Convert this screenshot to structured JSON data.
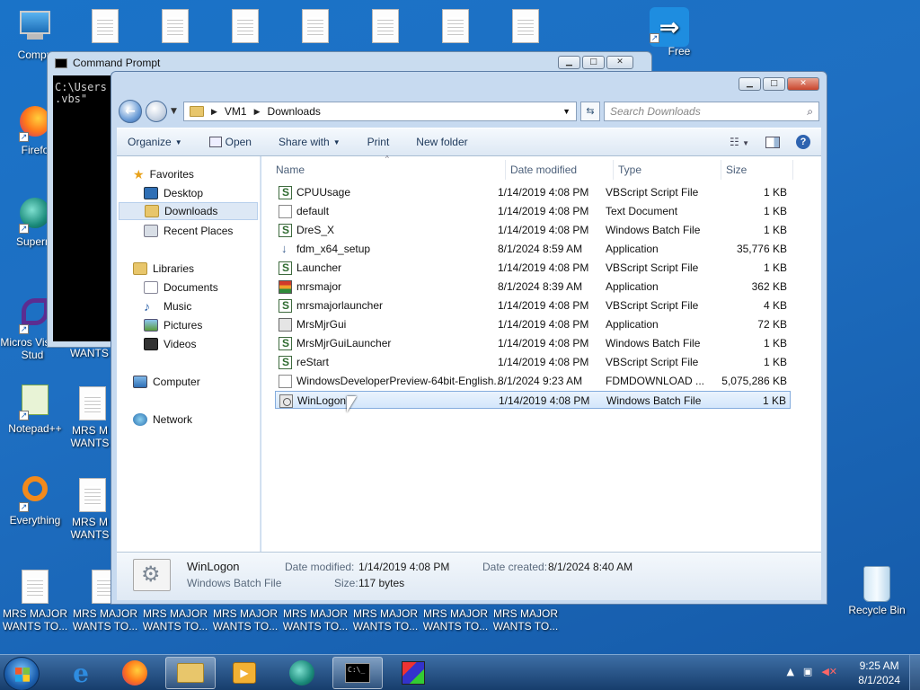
{
  "desktop": {
    "icons": [
      {
        "label": "Compu"
      },
      {
        "label": "Firefo"
      },
      {
        "label": "Superm"
      },
      {
        "label": "Micros Visual Stud"
      },
      {
        "label": "Notepad++"
      },
      {
        "label": "Everything"
      },
      {
        "label": "Free"
      },
      {
        "label": "Recycle Bin"
      }
    ],
    "mrs_label": "MRS MAJOR WANTS TO...",
    "partial_label": "MRS M WANTS",
    "partial_label_short": "WANTS"
  },
  "cmd": {
    "title": "Command Prompt",
    "lines": [
      "C:\\Users",
      ".vbs\""
    ]
  },
  "explorer": {
    "breadcrumb": [
      "VM1",
      "Downloads"
    ],
    "search_placeholder": "Search Downloads",
    "toolbar": {
      "organize": "Organize",
      "open": "Open",
      "share_with": "Share with",
      "print": "Print",
      "new_folder": "New folder"
    },
    "nav": {
      "favorites": "Favorites",
      "desktop": "Desktop",
      "downloads": "Downloads",
      "recent_places": "Recent Places",
      "libraries": "Libraries",
      "documents": "Documents",
      "music": "Music",
      "pictures": "Pictures",
      "videos": "Videos",
      "computer": "Computer",
      "network": "Network"
    },
    "columns": {
      "name": "Name",
      "date": "Date modified",
      "type": "Type",
      "size": "Size"
    },
    "files": [
      {
        "name": "CPUUsage",
        "date": "1/14/2019 4:08 PM",
        "type": "VBScript Script File",
        "size": "1 KB",
        "icon": "script"
      },
      {
        "name": "default",
        "date": "1/14/2019 4:08 PM",
        "type": "Text Document",
        "size": "1 KB",
        "icon": "txt"
      },
      {
        "name": "DreS_X",
        "date": "1/14/2019 4:08 PM",
        "type": "Windows Batch File",
        "size": "1 KB",
        "icon": "script"
      },
      {
        "name": "fdm_x64_setup",
        "date": "8/1/2024 8:59 AM",
        "type": "Application",
        "size": "35,776 KB",
        "icon": "dl"
      },
      {
        "name": "Launcher",
        "date": "1/14/2019 4:08 PM",
        "type": "VBScript Script File",
        "size": "1 KB",
        "icon": "script"
      },
      {
        "name": "mrsmajor",
        "date": "8/1/2024 8:39 AM",
        "type": "Application",
        "size": "362 KB",
        "icon": "mrs"
      },
      {
        "name": "mrsmajorlauncher",
        "date": "1/14/2019 4:08 PM",
        "type": "VBScript Script File",
        "size": "4 KB",
        "icon": "script"
      },
      {
        "name": "MrsMjrGui",
        "date": "1/14/2019 4:08 PM",
        "type": "Application",
        "size": "72 KB",
        "icon": "app"
      },
      {
        "name": "MrsMjrGuiLauncher",
        "date": "1/14/2019 4:08 PM",
        "type": "Windows Batch File",
        "size": "1 KB",
        "icon": "script"
      },
      {
        "name": "reStart",
        "date": "1/14/2019 4:08 PM",
        "type": "VBScript Script File",
        "size": "1 KB",
        "icon": "script"
      },
      {
        "name": "WindowsDeveloperPreview-64bit-English...",
        "date": "8/1/2024 9:23 AM",
        "type": "FDMDOWNLOAD ...",
        "size": "5,075,286 KB",
        "icon": "txt"
      },
      {
        "name": "WinLogon",
        "date": "1/14/2019 4:08 PM",
        "type": "Windows Batch File",
        "size": "1 KB",
        "icon": "bat",
        "selected": true
      }
    ],
    "details": {
      "name": "WinLogon",
      "type": "Windows Batch File",
      "date_modified_label": "Date modified:",
      "date_modified": "1/14/2019 4:08 PM",
      "size_label": "Size:",
      "size": "117 bytes",
      "date_created_label": "Date created:",
      "date_created": "8/1/2024 8:40 AM"
    }
  },
  "taskbar": {
    "time": "9:25 AM",
    "date": "8/1/2024"
  },
  "colors": {
    "desktop_blue": "#1a73c8",
    "selection": "#d3e6fb",
    "selection_border": "#84acdd"
  }
}
